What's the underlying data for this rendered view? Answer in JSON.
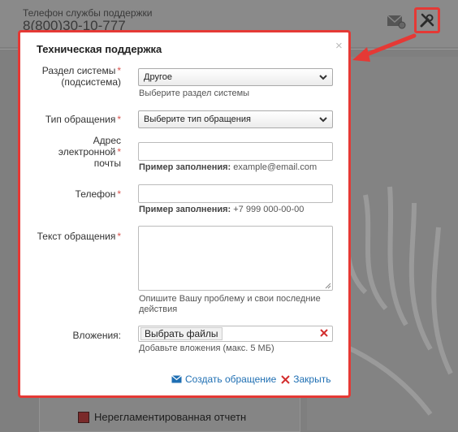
{
  "background": {
    "support_label": "Телефон службы поддержки",
    "support_phone": "8(800)30-10-777",
    "bottom_item": "Нерегламентированная отчетн"
  },
  "dialog": {
    "title": "Техническая поддержка",
    "close_symbol": "×",
    "fields": {
      "section": {
        "label_line1": "Раздел системы",
        "label_line2": "(подсистема)",
        "value": "Другое",
        "hint": "Выберите раздел системы"
      },
      "request_type": {
        "label": "Тип обращения",
        "value": "Выберите тип обращения"
      },
      "email": {
        "label_line1": "Адрес",
        "label_line2": "электронной",
        "label_line3": "почты",
        "value": "",
        "hint_bold": "Пример заполнения:",
        "hint_text": "example@email.com"
      },
      "phone": {
        "label": "Телефон",
        "value": "",
        "hint_bold": "Пример заполнения:",
        "hint_text": "+7 999 000-00-00"
      },
      "message": {
        "label": "Текст обращения",
        "value": "",
        "hint": "Опишите Вашу проблему и свои последние действия"
      },
      "attachments": {
        "label": "Вложения:",
        "button": "Выбрать файлы",
        "hint": "Добавьте вложения (макс. 5 МБ)"
      }
    },
    "required_mark": "*",
    "actions": {
      "create": "Создать обращение",
      "close": "Закрыть"
    }
  },
  "colors": {
    "highlight": "#e53935",
    "link": "#1f6fb3",
    "required": "#d9534f"
  }
}
